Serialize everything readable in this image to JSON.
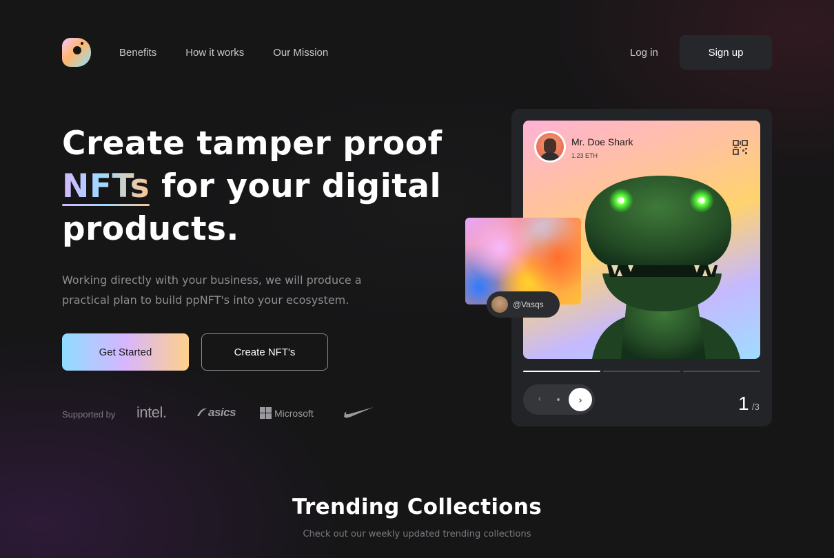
{
  "nav": {
    "items": [
      {
        "label": "Benefits"
      },
      {
        "label": "How it works"
      },
      {
        "label": "Our Mission"
      }
    ],
    "login_label": "Log in",
    "signup_label": "Sign up"
  },
  "hero": {
    "headline_before": "Create tamper proof ",
    "headline_highlight": "NFTs",
    "headline_after": " for your digital products.",
    "subtitle": "Working directly with your business, we will produce a practical plan to build ppNFT's into your ecosystem.",
    "primary_cta": "Get Started",
    "secondary_cta": "Create NFT's",
    "supported_label": "Supported by",
    "brands": {
      "intel": "intel.",
      "asics": "asics",
      "microsoft": "Microsoft",
      "nike": "nike-swoosh-icon"
    }
  },
  "nft_card": {
    "owner_name": "Mr. Doe Shark",
    "owner_price": "1.23 ETH",
    "qr_icon": "qr-code-icon",
    "creator_handle": "@Vasqs",
    "slide_current": "1",
    "slide_total": "/3",
    "progress_active_segment": 1,
    "progress_segments": 3
  },
  "trending": {
    "title": "Trending Collections",
    "subtitle": "Check out our weekly updated trending collections"
  },
  "colors": {
    "background": "#161617",
    "panel": "#232427",
    "signup_bg": "#26272a",
    "accent_gradient": [
      "#8fdcff",
      "#d7b6ff",
      "#ffd08a"
    ]
  }
}
